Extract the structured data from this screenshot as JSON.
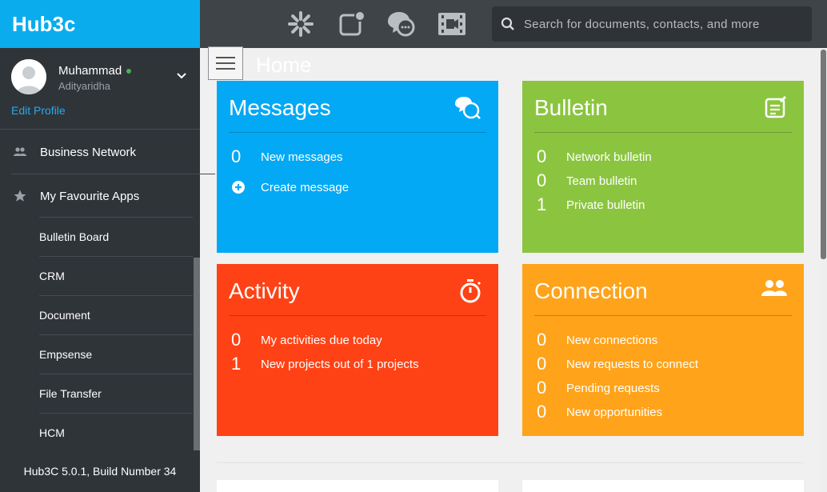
{
  "app": {
    "brand": "Hub3c",
    "version": "Hub3C 5.0.1, Build Number 34"
  },
  "profile": {
    "name": "Muhammad",
    "username": "Adityaridha",
    "edit_label": "Edit Profile",
    "status_color": "#4caf50"
  },
  "sidebar": {
    "items": [
      {
        "label": "Business Network",
        "icon": "people-icon"
      },
      {
        "label": "My Favourite Apps",
        "icon": "star-icon"
      }
    ],
    "sub_items": [
      "Bulletin Board",
      "CRM",
      "Document",
      "Empsense",
      "File Transfer",
      "HCM"
    ]
  },
  "topbar": {
    "icons": [
      "apps-pinwheel-icon",
      "notification-icon",
      "chat-icon",
      "video-icon"
    ],
    "search_placeholder": "Search for documents, contacts, and more"
  },
  "page": {
    "title": "Home"
  },
  "cards": {
    "messages": {
      "title": "Messages",
      "color": "#03a9f4",
      "rows": [
        {
          "num": "0",
          "label": "New messages"
        },
        {
          "label": "Create message"
        }
      ]
    },
    "bulletin": {
      "title": "Bulletin",
      "color": "#8bc540",
      "rows": [
        {
          "num": "0",
          "label": "Network bulletin"
        },
        {
          "num": "0",
          "label": "Team bulletin"
        },
        {
          "num": "1",
          "label": "Private bulletin"
        }
      ]
    },
    "activity": {
      "title": "Activity",
      "color": "#ff4215",
      "rows": [
        {
          "num": "0",
          "label": "My activities due today"
        },
        {
          "num": "1",
          "label": "New projects out of 1 projects"
        }
      ]
    },
    "connection": {
      "title": "Connection",
      "color": "#ffa31a",
      "rows": [
        {
          "num": "0",
          "label": "New connections"
        },
        {
          "num": "0",
          "label": "New requests to connect"
        },
        {
          "num": "0",
          "label": "Pending requests"
        },
        {
          "num": "0",
          "label": "New opportunities"
        }
      ]
    }
  }
}
